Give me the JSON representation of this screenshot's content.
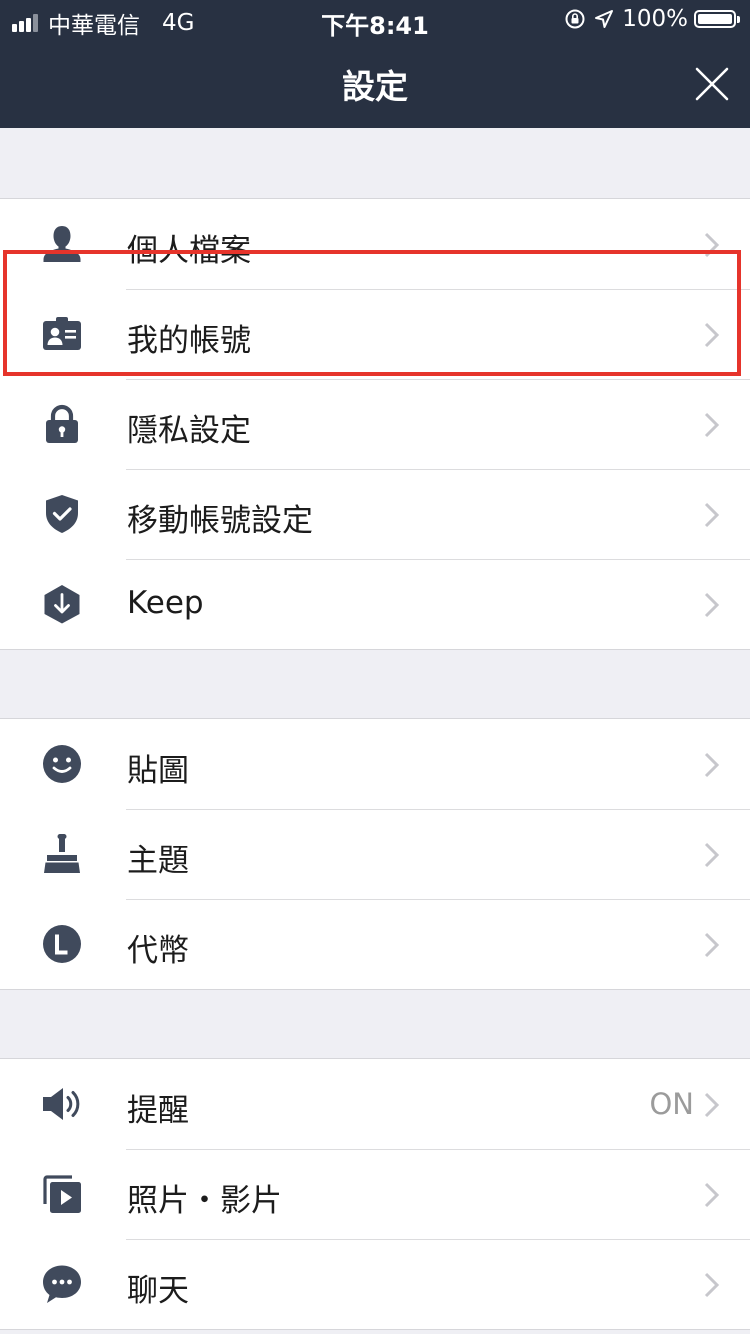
{
  "status_bar": {
    "carrier": "中華電信",
    "network": "4G",
    "time": "下午8:41",
    "battery": "100%"
  },
  "header": {
    "title": "設定"
  },
  "sections": [
    {
      "items": [
        {
          "label": "個人檔案",
          "icon": "person-icon"
        },
        {
          "label": "我的帳號",
          "icon": "id-card-icon"
        },
        {
          "label": "隱私設定",
          "icon": "lock-icon"
        },
        {
          "label": "移動帳號設定",
          "icon": "shield-check-icon"
        },
        {
          "label": "Keep",
          "icon": "keep-icon"
        }
      ]
    },
    {
      "items": [
        {
          "label": "貼圖",
          "icon": "smiley-icon"
        },
        {
          "label": "主題",
          "icon": "brush-icon"
        },
        {
          "label": "代幣",
          "icon": "coin-icon"
        }
      ]
    },
    {
      "items": [
        {
          "label": "提醒",
          "value": "ON",
          "icon": "speaker-icon"
        },
        {
          "label": "照片・影片",
          "icon": "photo-video-icon"
        },
        {
          "label": "聊天",
          "icon": "chat-bubble-icon"
        }
      ]
    }
  ],
  "colors": {
    "header_bg": "#283142",
    "icon": "#404a5c",
    "highlight": "#e6342b"
  }
}
